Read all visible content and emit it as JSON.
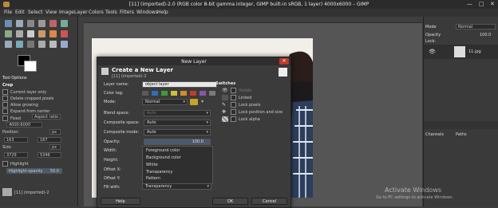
{
  "window": {
    "title": "[11] (imported)-2.0 (RGB color 8-bit gamma integer, GIMP built-in sRGB, 1 layer) 4000x6000 – GIMP",
    "minimize": "—",
    "maximize": "□",
    "close": "✕"
  },
  "menu": [
    "File",
    "Edit",
    "Select",
    "View",
    "Image",
    "Layer",
    "Colors",
    "Tools",
    "Filters",
    "Windows",
    "Help"
  ],
  "toolbox": {
    "tool_options_tab": "Tool Options",
    "crop_title": "Crop",
    "current_layer_only": "Current layer only",
    "delete_cropped_pixels": "Delete cropped pixels",
    "allow_growing": "Allow growing",
    "expand_from_center": "Expand from center",
    "fixed": "Fixed",
    "aspect_ratio": "Aspect ratio",
    "ratio_value": "4000:6000",
    "position_label": "Position:",
    "position_unit": "px",
    "pos_x": "163",
    "pos_y": "187",
    "size_label": "Size:",
    "size_unit": "px",
    "size_w": "3729",
    "size_h": "5346",
    "highlight": "Highlight",
    "highlight_opacity_label": "Highlight opacity",
    "highlight_opacity_value": "50.0",
    "image_tab_label": "[11] (imported)-2"
  },
  "right_panel": {
    "mode_label": "Mode",
    "mode_value": "Normal",
    "opacity_label": "Opacity",
    "opacity_value": "100.0",
    "lock_label": "Lock:",
    "layer_name": "11.jpg",
    "tab_channels": "Channels",
    "tab_paths": "Paths"
  },
  "dialog": {
    "window_title": "New Layer",
    "heading": "Create a New Layer",
    "subheading": "[11] (imported)-2",
    "layer_name_label": "Layer name:",
    "layer_name_value": "object layer",
    "color_tag_label": "Color tag:",
    "mode_label": "Mode:",
    "mode_value": "Normal",
    "blend_space_label": "Blend space:",
    "blend_space_value": "Auto",
    "composite_space_label": "Composite space:",
    "composite_space_value": "Auto",
    "composite_mode_label": "Composite mode:",
    "composite_mode_value": "Auto",
    "opacity_label": "Opacity:",
    "opacity_value": "100.0",
    "width_label": "Width:",
    "height_label": "Height:",
    "offset_x_label": "Offset X:",
    "offset_y_label": "Offset Y:",
    "fill_with_label": "Fill with:",
    "fill_with_value": "Transparency",
    "fill_options": [
      "Foreground color",
      "Background color",
      "White",
      "Transparency",
      "Pattern"
    ],
    "switches_label": "Switches",
    "switch_visible": "Visible",
    "switch_linked": "Linked",
    "switch_lock_pixels": "Lock pixels",
    "switch_lock_position": "Lock position and size",
    "switch_lock_alpha": "Lock alpha",
    "help_button": "Help",
    "ok_button": "OK",
    "cancel_button": "Cancel"
  },
  "watermark": {
    "line1": "Activate Windows",
    "line2": "Go to PC settings to activate Windows."
  },
  "colors": {
    "color_tags": [
      "#5a5a5a",
      "#2f6fb7",
      "#3f9a3a",
      "#c9c23a",
      "#d58a2a",
      "#c23a2a",
      "#8a55a8",
      "#7a7a7a"
    ]
  }
}
